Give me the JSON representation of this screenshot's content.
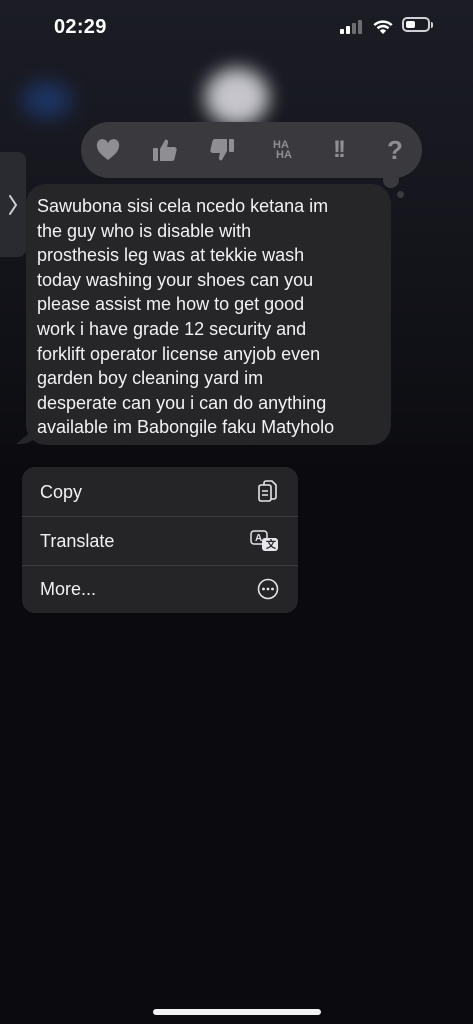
{
  "status_bar": {
    "time": "02:29"
  },
  "reactions": {
    "items": [
      {
        "name": "heart"
      },
      {
        "name": "thumbs-up"
      },
      {
        "name": "thumbs-down"
      },
      {
        "name": "haha",
        "text_top": "HA",
        "text_bottom": "HA"
      },
      {
        "name": "exclamation",
        "text": "!!"
      },
      {
        "name": "question",
        "text": "?"
      }
    ]
  },
  "message": {
    "lines": [
      "Sawubona sisi cela ncedo ketana im",
      "the guy who is disable with",
      "prosthesis leg was at tekkie wash",
      "today washing your shoes can you",
      "please assist me how to get good",
      "work i have grade 12 security and",
      "forklift operator license anyjob even",
      "garden boy cleaning yard im",
      "desperate can you i can do anything",
      "available im Babongile faku Matyholo"
    ]
  },
  "context_menu": {
    "copy_label": "Copy",
    "translate_label": "Translate",
    "more_label": "More..."
  },
  "colors": {
    "background": "#0b0b0f",
    "bubble": "#262629",
    "reactions_bar": "#3a3a3e",
    "menu": "#252528"
  }
}
